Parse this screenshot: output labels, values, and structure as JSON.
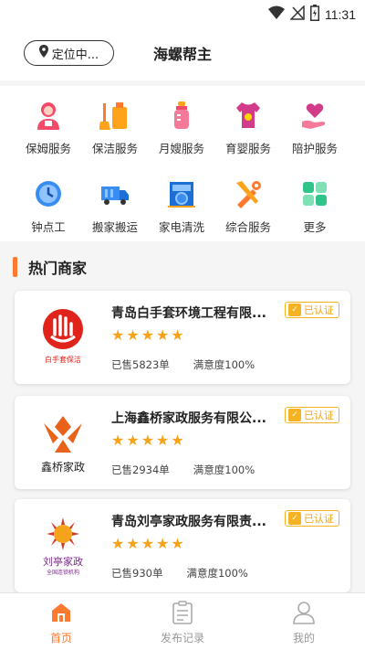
{
  "status": {
    "time": "11:31"
  },
  "header": {
    "location_label": "定位中...",
    "title": "海螺帮主"
  },
  "services": [
    {
      "label": "保姆服务",
      "icon": "nanny-icon"
    },
    {
      "label": "保洁服务",
      "icon": "cleaning-icon"
    },
    {
      "label": "月嫂服务",
      "icon": "bottle-icon"
    },
    {
      "label": "育婴服务",
      "icon": "baby-clothes-icon"
    },
    {
      "label": "陪护服务",
      "icon": "heart-hand-icon"
    },
    {
      "label": "钟点工",
      "icon": "clock-icon"
    },
    {
      "label": "搬家搬运",
      "icon": "truck-icon"
    },
    {
      "label": "家电清洗",
      "icon": "appliance-icon"
    },
    {
      "label": "综合服务",
      "icon": "tools-icon"
    },
    {
      "label": "更多",
      "icon": "more-grid-icon"
    }
  ],
  "section": {
    "title": "热门商家"
  },
  "merchants": [
    {
      "name": "青岛白手套环境工程有限...",
      "badge": "已认证",
      "stars": 5,
      "sold": "已售5823单",
      "satisfaction": "满意度100%",
      "logo_text": "白手套保洁"
    },
    {
      "name": "上海鑫桥家政服务有限公...",
      "badge": "已认证",
      "stars": 5,
      "sold": "已售2934单",
      "satisfaction": "满意度100%",
      "logo_text": "鑫桥家政"
    },
    {
      "name": "青岛刘亭家政服务有限责...",
      "badge": "已认证",
      "stars": 5,
      "sold": "已售930单",
      "satisfaction": "满意度100%",
      "logo_text": "刘亭家政",
      "logo_sub": "全国连锁机构"
    }
  ],
  "tabs": [
    {
      "label": "首页",
      "active": true
    },
    {
      "label": "发布记录",
      "active": false
    },
    {
      "label": "我的",
      "active": false
    }
  ],
  "colors": {
    "accent": "#ff7a2e",
    "star": "#f5a31a"
  }
}
